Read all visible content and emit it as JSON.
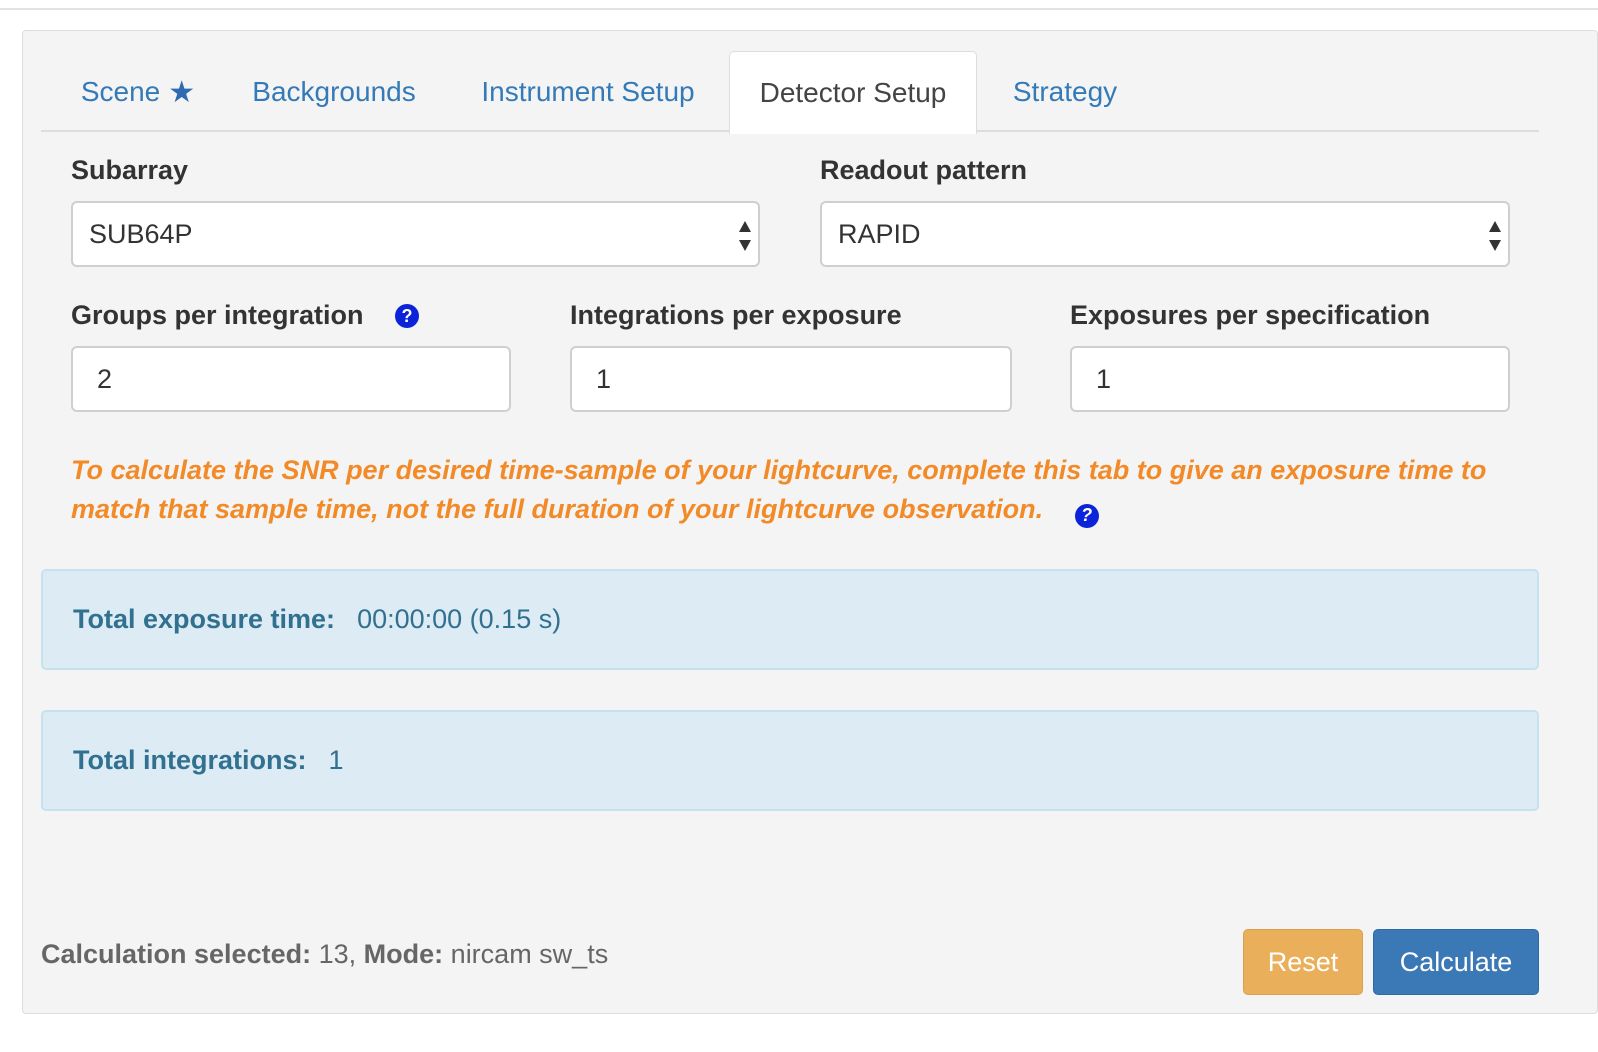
{
  "tabs": [
    {
      "label": "Scene",
      "icon": "star-icon",
      "active": false
    },
    {
      "label": "Backgrounds",
      "active": false
    },
    {
      "label": "Instrument Setup",
      "active": false
    },
    {
      "label": "Detector Setup",
      "active": true
    },
    {
      "label": "Strategy",
      "active": false
    }
  ],
  "tab_icons": {
    "star": "★"
  },
  "subarray": {
    "label": "Subarray",
    "value": "SUB64P"
  },
  "readout": {
    "label": "Readout pattern",
    "value": "RAPID"
  },
  "groups": {
    "label": "Groups per integration",
    "value": "2",
    "help": "?"
  },
  "integrations": {
    "label": "Integrations per exposure",
    "value": "1"
  },
  "exposures": {
    "label": "Exposures per specification",
    "value": "1"
  },
  "notice": {
    "text": "To calculate the SNR per desired time-sample of your lightcurve, complete this tab to give an exposure time to match that sample time, not the full duration of your lightcurve observation.",
    "help": "?"
  },
  "summary": {
    "exposure_time_label": "Total exposure time:",
    "exposure_time_value": "00:00:00 (0.15 s)",
    "integrations_label": "Total integrations:",
    "integrations_value": "1"
  },
  "footer": {
    "calc_label": "Calculation selected:",
    "calc_value": "13,",
    "mode_label": "Mode:",
    "mode_value": "nircam sw_ts"
  },
  "buttons": {
    "reset": "Reset",
    "calculate": "Calculate"
  },
  "colors": {
    "link": "#337ab7",
    "notice": "#f28a28",
    "info_bg": "#dcebf4",
    "info_text": "#31708f",
    "help_icon": "#0b24d9",
    "reset": "#eaaf5b",
    "calculate": "#3b78b6"
  }
}
